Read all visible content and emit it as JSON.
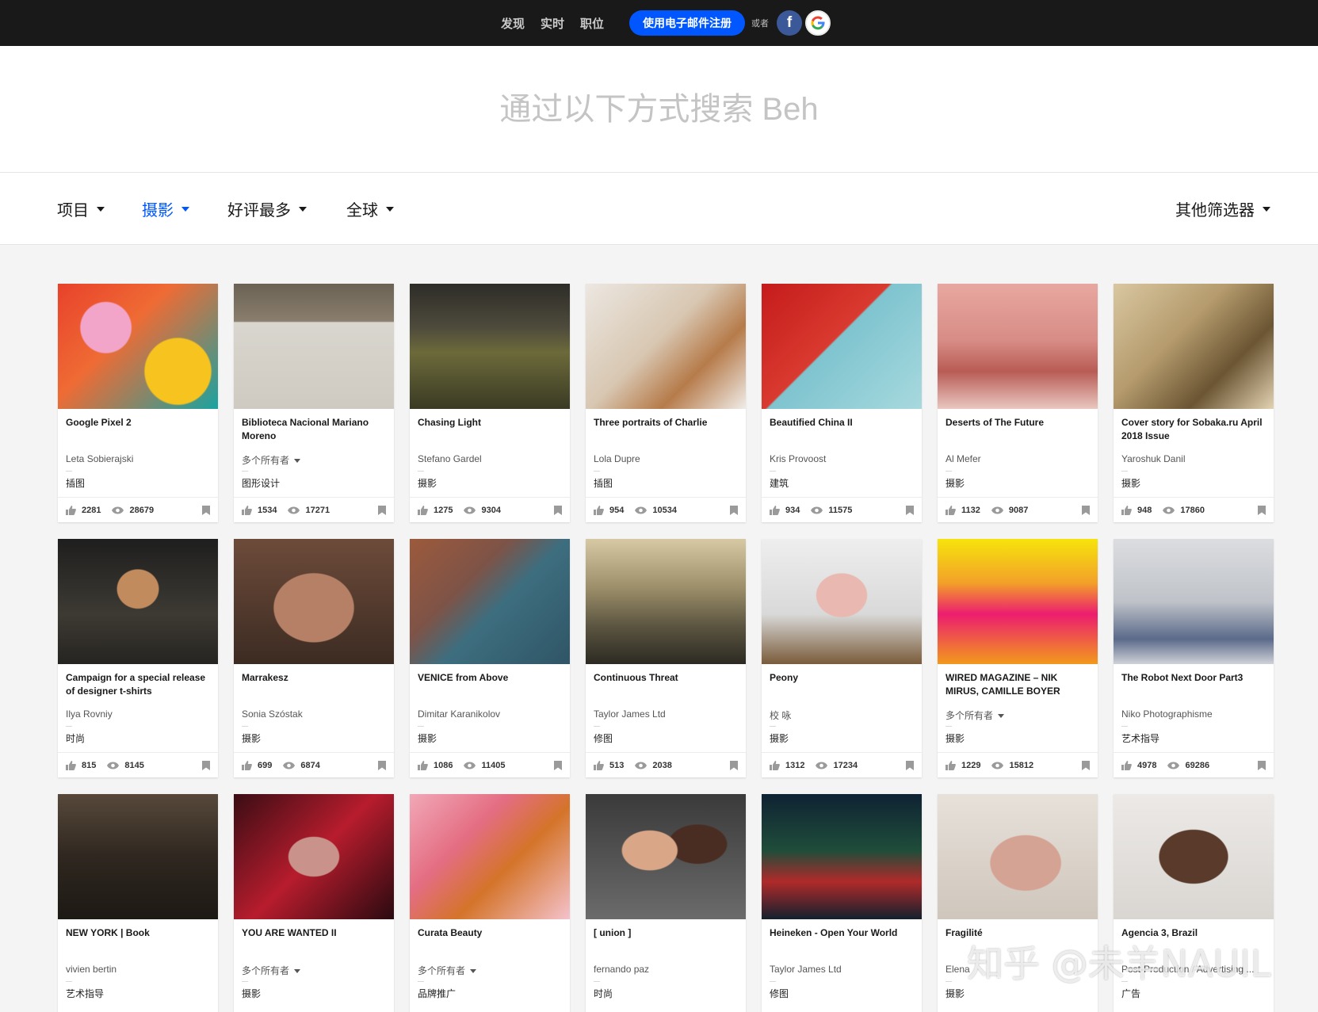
{
  "topnav": {
    "links": [
      "发现",
      "实时",
      "职位"
    ],
    "signup_label": "使用电子邮件注册",
    "or_text": "或者",
    "facebook_glyph": "f"
  },
  "search": {
    "placeholder": "通过以下方式搜索 Beh"
  },
  "filters": {
    "type": "项目",
    "field": "摄影",
    "sort": "好评最多",
    "region": "全球",
    "more": "其他筛选器",
    "active_color": "#0057ff"
  },
  "cards": [
    {
      "title": "Google Pixel 2",
      "owner": "Leta Sobierajski",
      "multi_owner": false,
      "field": "插图",
      "likes": "2281",
      "views": "28679"
    },
    {
      "title": "Biblioteca Nacional Mariano Moreno",
      "owner": "多个所有者",
      "multi_owner": true,
      "field": "图形设计",
      "likes": "1534",
      "views": "17271"
    },
    {
      "title": "Chasing Light",
      "owner": "Stefano Gardel",
      "multi_owner": false,
      "field": "摄影",
      "likes": "1275",
      "views": "9304"
    },
    {
      "title": "Three portraits of Charlie",
      "owner": "Lola Dupre",
      "multi_owner": false,
      "field": "插图",
      "likes": "954",
      "views": "10534"
    },
    {
      "title": "Beautified China II",
      "owner": "Kris Provoost",
      "multi_owner": false,
      "field": "建筑",
      "likes": "934",
      "views": "11575"
    },
    {
      "title": "Deserts of The Future",
      "owner": "Al Mefer",
      "multi_owner": false,
      "field": "摄影",
      "likes": "1132",
      "views": "9087"
    },
    {
      "title": "Cover story for Sobaka.ru April 2018 Issue",
      "owner": "Yaroshuk Danil",
      "multi_owner": false,
      "field": "摄影",
      "likes": "948",
      "views": "17860"
    },
    {
      "title": "Campaign for a special release of designer t-shirts",
      "owner": "Ilya Rovniy",
      "multi_owner": false,
      "field": "时尚",
      "likes": "815",
      "views": "8145"
    },
    {
      "title": "Marrakesz",
      "owner": "Sonia Szóstak",
      "multi_owner": false,
      "field": "摄影",
      "likes": "699",
      "views": "6874"
    },
    {
      "title": "VENICE from Above",
      "owner": "Dimitar Karanikolov",
      "multi_owner": false,
      "field": "摄影",
      "likes": "1086",
      "views": "11405"
    },
    {
      "title": "Continuous Threat",
      "owner": "Taylor James Ltd",
      "multi_owner": false,
      "field": "修图",
      "likes": "513",
      "views": "2038"
    },
    {
      "title": "Peony",
      "owner": "校 咏",
      "multi_owner": false,
      "field": "摄影",
      "likes": "1312",
      "views": "17234"
    },
    {
      "title": "WIRED MAGAZINE – NIK MIRUS, CAMILLE BOYER",
      "owner": "多个所有者",
      "multi_owner": true,
      "field": "摄影",
      "likes": "1229",
      "views": "15812"
    },
    {
      "title": "The Robot Next Door Part3",
      "owner": "Niko Photographisme",
      "multi_owner": false,
      "field": "艺术指导",
      "likes": "4978",
      "views": "69286"
    },
    {
      "title": "NEW YORK | Book",
      "owner": "vivien bertin",
      "multi_owner": false,
      "field": "艺术指导",
      "likes": "",
      "views": ""
    },
    {
      "title": "YOU ARE WANTED II",
      "owner": "多个所有者",
      "multi_owner": true,
      "field": "摄影",
      "likes": "",
      "views": ""
    },
    {
      "title": "Curata Beauty",
      "owner": "多个所有者",
      "multi_owner": true,
      "field": "品牌推广",
      "likes": "",
      "views": ""
    },
    {
      "title": "[ union ]",
      "owner": "fernando paz",
      "multi_owner": false,
      "field": "时尚",
      "likes": "",
      "views": ""
    },
    {
      "title": "Heineken - Open Your World",
      "owner": "Taylor James Ltd",
      "multi_owner": false,
      "field": "修图",
      "likes": "",
      "views": ""
    },
    {
      "title": "Fragilité",
      "owner": "Elena",
      "multi_owner": false,
      "field": "摄影",
      "likes": "",
      "views": ""
    },
    {
      "title": "Agencia 3, Brazil",
      "owner": "Post-Production / Advertising ...",
      "multi_owner": false,
      "field": "广告",
      "likes": "",
      "views": ""
    }
  ],
  "watermark": "知乎 @未羊NAUIL"
}
